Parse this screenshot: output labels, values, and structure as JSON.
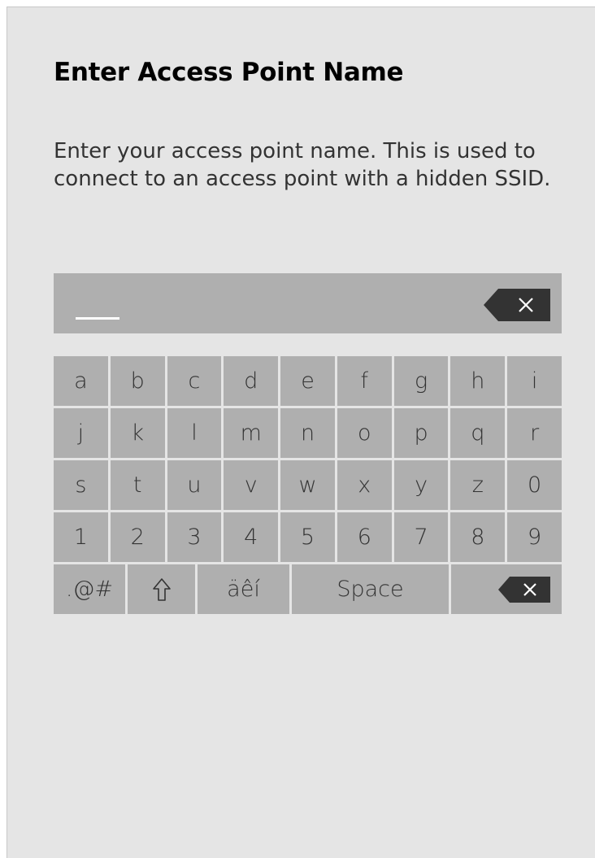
{
  "title": "Enter Access Point Name",
  "description": "Enter your access point name. This is used to connect to an access point with a hidden SSID.",
  "input": {
    "value": "",
    "clear_icon": "backspace-x-icon"
  },
  "keyboard": {
    "rows": [
      [
        "a",
        "b",
        "c",
        "d",
        "e",
        "f",
        "g",
        "h",
        "i"
      ],
      [
        "j",
        "k",
        "l",
        "m",
        "n",
        "o",
        "p",
        "q",
        "r"
      ],
      [
        "s",
        "t",
        "u",
        "v",
        "w",
        "x",
        "y",
        "z",
        "0"
      ],
      [
        "1",
        "2",
        "3",
        "4",
        "5",
        "6",
        "7",
        "8",
        "9"
      ]
    ],
    "symbols_label": ".@#",
    "shift_icon": "shift-arrow-icon",
    "accents_label": "äêí",
    "space_label": "Space",
    "delete_icon": "backspace-x-icon"
  },
  "colors": {
    "panel": "#e5e5e5",
    "key": "#afafaf",
    "text": "#333333"
  }
}
